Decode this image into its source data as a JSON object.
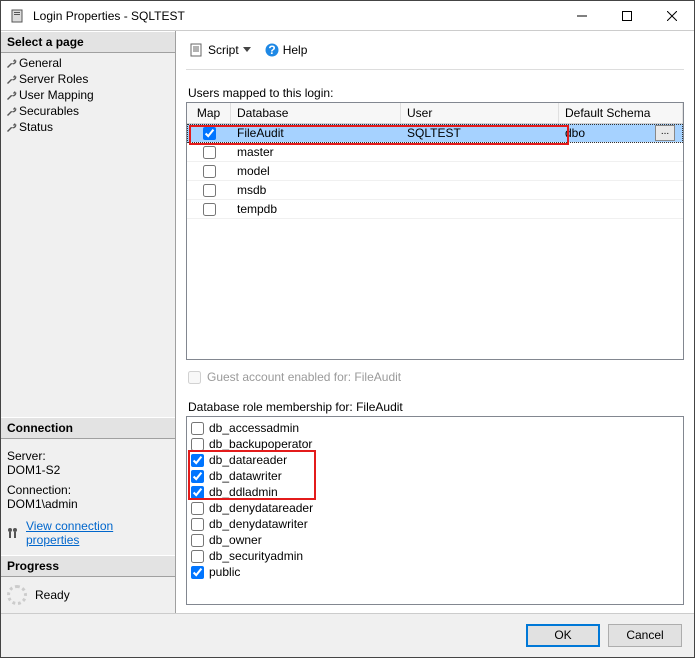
{
  "window": {
    "title": "Login Properties - SQLTEST"
  },
  "left": {
    "select_page_header": "Select a page",
    "nav": [
      {
        "label": "General"
      },
      {
        "label": "Server Roles"
      },
      {
        "label": "User Mapping"
      },
      {
        "label": "Securables"
      },
      {
        "label": "Status"
      }
    ],
    "connection_header": "Connection",
    "server_label": "Server:",
    "server_value": "DOM1-S2",
    "conn_label": "Connection:",
    "conn_value": "DOM1\\admin",
    "view_props": "View connection properties",
    "progress_header": "Progress",
    "progress_status": "Ready"
  },
  "toolbar": {
    "script": "Script",
    "help": "Help"
  },
  "mapping": {
    "label": "Users mapped to this login:",
    "columns": {
      "map": "Map",
      "database": "Database",
      "user": "User",
      "schema": "Default Schema"
    },
    "rows": [
      {
        "checked": true,
        "database": "FileAudit",
        "user": "SQLTEST",
        "schema": "dbo",
        "selected": true
      },
      {
        "checked": false,
        "database": "master",
        "user": "",
        "schema": ""
      },
      {
        "checked": false,
        "database": "model",
        "user": "",
        "schema": ""
      },
      {
        "checked": false,
        "database": "msdb",
        "user": "",
        "schema": ""
      },
      {
        "checked": false,
        "database": "tempdb",
        "user": "",
        "schema": ""
      }
    ],
    "guest_label": "Guest account enabled for: FileAudit"
  },
  "roles": {
    "label": "Database role membership for: FileAudit",
    "items": [
      {
        "name": "db_accessadmin",
        "checked": false
      },
      {
        "name": "db_backupoperator",
        "checked": false
      },
      {
        "name": "db_datareader",
        "checked": true
      },
      {
        "name": "db_datawriter",
        "checked": true
      },
      {
        "name": "db_ddladmin",
        "checked": true
      },
      {
        "name": "db_denydatareader",
        "checked": false
      },
      {
        "name": "db_denydatawriter",
        "checked": false
      },
      {
        "name": "db_owner",
        "checked": false
      },
      {
        "name": "db_securityadmin",
        "checked": false
      },
      {
        "name": "public",
        "checked": true
      }
    ]
  },
  "footer": {
    "ok": "OK",
    "cancel": "Cancel"
  }
}
